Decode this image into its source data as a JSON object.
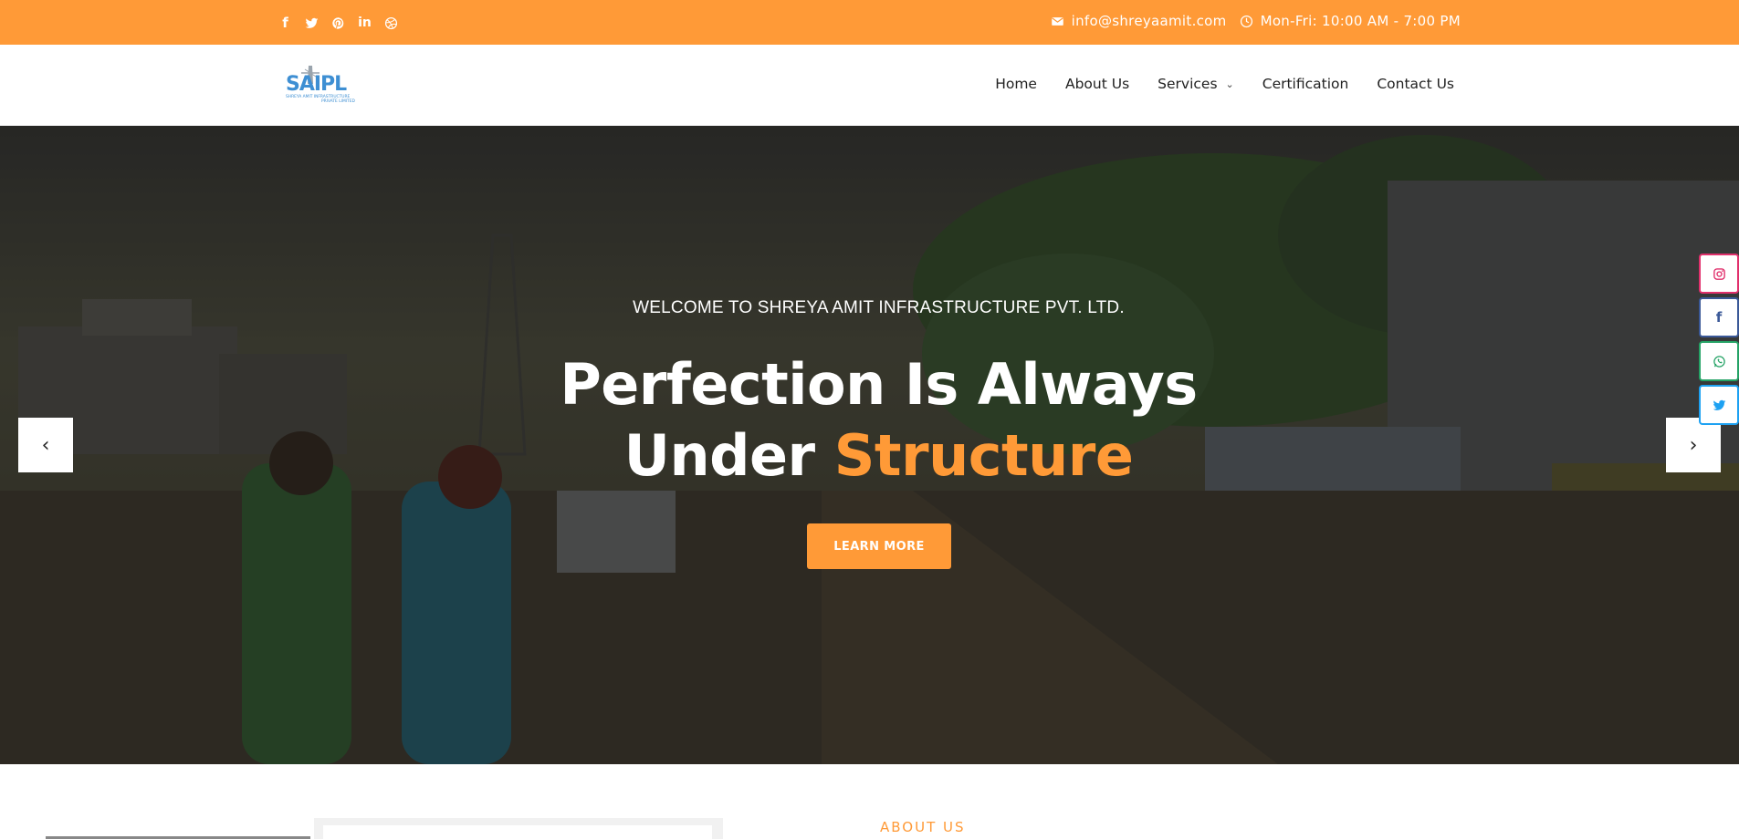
{
  "topbar": {
    "socials": [
      {
        "name": "facebook-icon",
        "glyph": "f"
      },
      {
        "name": "twitter-icon",
        "glyph": "🐦"
      },
      {
        "name": "pinterest-icon",
        "glyph": "P"
      },
      {
        "name": "linkedin-icon",
        "glyph": "in"
      },
      {
        "name": "dribbble-icon",
        "glyph": "◎"
      }
    ],
    "email": "info@shreyaamit.com",
    "hours": "Mon-Fri: 10:00 AM - 7:00 PM",
    "background": "#ff9a37"
  },
  "header": {
    "logo_text": "SAIPL",
    "logo_sub": "SHREYA AMIT INFRASTRUCTURE PRIVATE LIMITED",
    "nav": {
      "home": "Home",
      "about": "About Us",
      "services": "Services",
      "certification": "Certification",
      "contact": "Contact Us"
    }
  },
  "hero": {
    "welcome": "WELCOME TO SHREYA AMIT INFRASTRUCTURE PVT. LTD.",
    "headline_line1": "Perfection Is Always",
    "headline_line2_plain": "Under ",
    "headline_line2_accent": "Structure",
    "cta": "LEARN MORE",
    "accent_color": "#ff9a37",
    "prev_glyph": "‹",
    "next_glyph": "›"
  },
  "floating_social": [
    {
      "name": "instagram-icon",
      "glyph": "◎",
      "color": "#e1306c"
    },
    {
      "name": "facebook-icon",
      "glyph": "f",
      "color": "#3b5998"
    },
    {
      "name": "whatsapp-icon",
      "glyph": "✆",
      "color": "#25a366"
    },
    {
      "name": "twitter-icon",
      "glyph": "🐦",
      "color": "#1da1f2"
    }
  ],
  "about": {
    "label": "ABOUT US"
  }
}
